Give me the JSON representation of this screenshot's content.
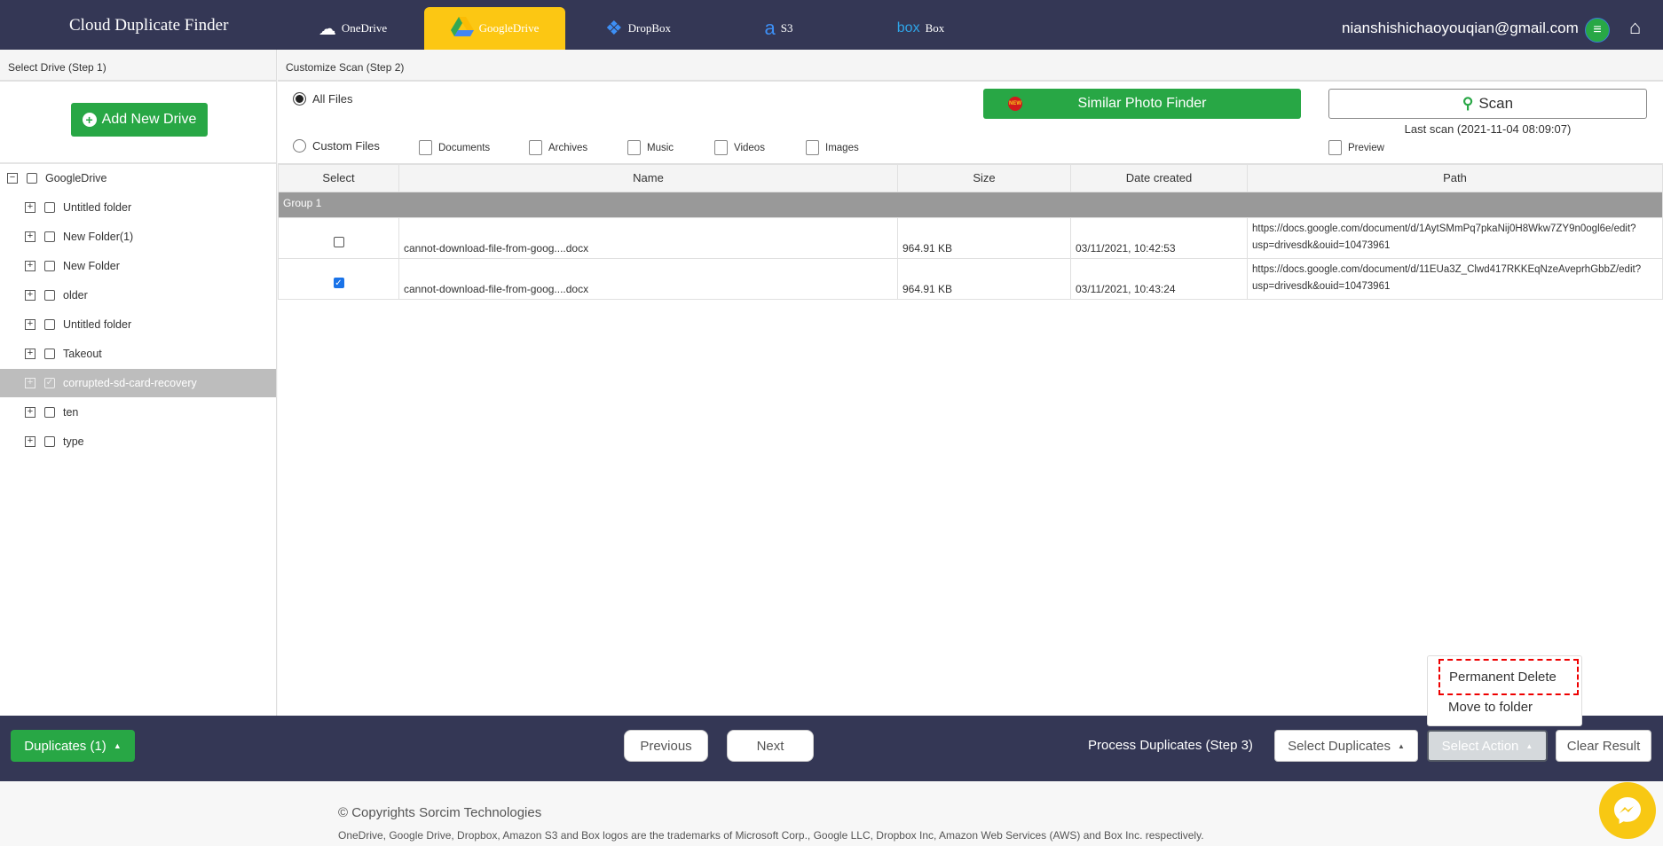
{
  "header": {
    "title": "Cloud Duplicate Finder",
    "email": "nianshishichaoyouqian@gmail.com",
    "tabs": [
      {
        "label": "OneDrive",
        "icon": "onedrive-icon"
      },
      {
        "label": "GoogleDrive",
        "icon": "googledrive-icon",
        "active": true
      },
      {
        "label": "DropBox",
        "icon": "dropbox-icon"
      },
      {
        "label": "S3",
        "icon": "amazon-s3-icon"
      },
      {
        "label": "Box",
        "icon": "box-icon",
        "logo_text": "box"
      }
    ]
  },
  "left": {
    "step_title": "Select Drive (Step 1)",
    "add_drive": "Add New Drive",
    "tree": {
      "root": "GoogleDrive",
      "items": [
        "Untitled folder",
        "New Folder(1)",
        "New Folder",
        "older",
        "Untitled folder",
        "Takeout",
        "corrupted-sd-card-recovery",
        "ten",
        "type"
      ],
      "selected": "corrupted-sd-card-recovery"
    }
  },
  "right": {
    "step_title": "Customize Scan (Step 2)",
    "all_files": "All Files",
    "custom_files": "Custom Files",
    "file_types": [
      "Documents",
      "Archives",
      "Music",
      "Videos",
      "Images"
    ],
    "photo_finder": "Similar Photo Finder",
    "new_badge": "NEW",
    "scan": "Scan",
    "last_scan": "Last scan (2021-11-04 08:09:07)",
    "preview": "Preview"
  },
  "table": {
    "headers": [
      "Select",
      "Name",
      "Size",
      "Date created",
      "Path"
    ],
    "group": "Group 1",
    "rows": [
      {
        "checked": false,
        "name": "cannot-download-file-from-goog....docx",
        "size": "964.91 KB",
        "date": "03/11/2021, 10:42:53",
        "path1": "https://docs.google.com/document/d/1AytSMmPq7pkaNij0H8Wkw7ZY9n0ogl6e/edit?",
        "path2": "usp=drivesdk&ouid=10473961"
      },
      {
        "checked": true,
        "name": "cannot-download-file-from-goog....docx",
        "size": "964.91 KB",
        "date": "03/11/2021, 10:43:24",
        "path1": "https://docs.google.com/document/d/11EUa3Z_Clwd417RKKEqNzeAveprhGbbZ/edit?",
        "path2": "usp=drivesdk&ouid=10473961"
      }
    ]
  },
  "dropdown": {
    "items": [
      "Permanent Delete",
      "Move to folder"
    ]
  },
  "bottom": {
    "duplicates": "Duplicates (1)",
    "previous": "Previous",
    "next": "Next",
    "step3": "Process Duplicates (Step 3)",
    "select_duplicates": "Select Duplicates",
    "select_action": "Select Action",
    "clear": "Clear Result"
  },
  "footer": {
    "copyright": "© Copyrights Sorcim Technologies",
    "trademark": "OneDrive, Google Drive, Dropbox, Amazon S3 and Box logos are the trademarks of Microsoft Corp., Google LLC, Dropbox Inc, Amazon Web Services (AWS) and Box Inc. respectively."
  },
  "colors": {
    "header": "#343755",
    "accent_green": "#28a745",
    "active_tab": "#fcc713",
    "messenger": "#f8c813"
  }
}
